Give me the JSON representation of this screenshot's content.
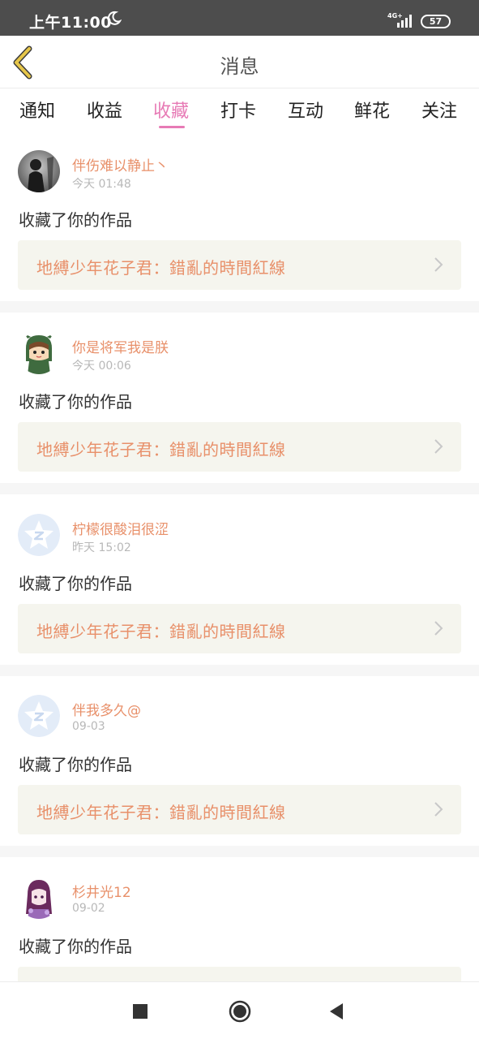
{
  "status_bar": {
    "time": "上午11:00",
    "network_label": "4G+",
    "battery": "57"
  },
  "header": {
    "title": "消息"
  },
  "tabs": [
    {
      "label": "通知",
      "active": false
    },
    {
      "label": "收益",
      "active": false
    },
    {
      "label": "收藏",
      "active": true
    },
    {
      "label": "打卡",
      "active": false
    },
    {
      "label": "互动",
      "active": false
    },
    {
      "label": "鲜花",
      "active": false
    },
    {
      "label": "关注",
      "active": false
    }
  ],
  "messages": [
    {
      "user": "伴伤难以静止丶",
      "time": "今天 01:48",
      "action": "收藏了你的作品",
      "work": "地縛少年花子君：錯亂的時間紅線",
      "avatar": "dark-figure-avatar"
    },
    {
      "user": "你是将军我是朕",
      "time": "今天 00:06",
      "action": "收藏了你的作品",
      "work": "地縛少年花子君：錯亂的時間紅線",
      "avatar": "cartoon-girl-avatar"
    },
    {
      "user": "柠檬很酸泪很涩",
      "time": "昨天 15:02",
      "action": "收藏了你的作品",
      "work": "地縛少年花子君：錯亂的時間紅線",
      "avatar": "default-star-avatar"
    },
    {
      "user": "伴我多久@",
      "time": "09-03",
      "action": "收藏了你的作品",
      "work": "地縛少年花子君：錯亂的時間紅線",
      "avatar": "default-star-avatar"
    },
    {
      "user": "杉井光12",
      "time": "09-02",
      "action": "收藏了你的作品",
      "work": "",
      "avatar": "anime-character-avatar"
    }
  ],
  "colors": {
    "accent": "#e77ab5",
    "username": "#e8906a",
    "card_bg": "#f5f5ee",
    "back_arrow": "#e6c64a"
  }
}
